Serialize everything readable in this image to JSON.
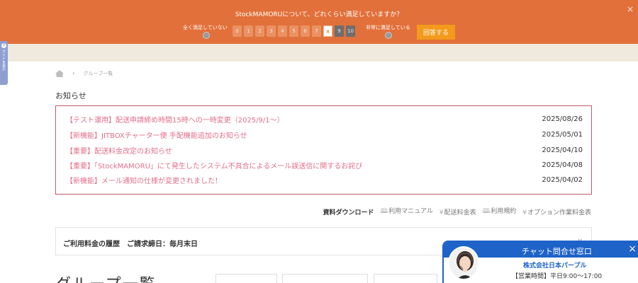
{
  "survey": {
    "question": "StockMAMORUについて、どれくらい満足していますか？",
    "low_label": "全く満足していない",
    "high_label": "非常に満足している",
    "scale": [
      "0",
      "1",
      "2",
      "3",
      "4",
      "5",
      "6",
      "7",
      "8",
      "9",
      "10"
    ],
    "selected": "8",
    "answer_label": "回答する",
    "close": "×"
  },
  "guide": {
    "icon": "?",
    "label": "ガイドを表示"
  },
  "breadcrumb": {
    "current": "グループ一覧",
    "separator": "›"
  },
  "news": {
    "title": "お知らせ",
    "items": [
      {
        "text": "【テスト運用】配送申請締め時間15時への一時変更（2025/9/1〜）",
        "date": "2025/08/26"
      },
      {
        "text": "【新機能】JITBOXチャーター便 手配機能追加のお知らせ",
        "date": "2025/05/01"
      },
      {
        "text": "【重要】配送料金改定のお知らせ",
        "date": "2025/04/10"
      },
      {
        "text": "【重要】「StockMAMORU」にて発生したシステム不具合によるメール誤送信に関するお詫び",
        "date": "2025/04/08"
      },
      {
        "text": "【新機能】メール通知の仕様が変更されました！",
        "date": "2025/04/02"
      }
    ]
  },
  "downloads": {
    "title": "資料ダウンロード",
    "items": [
      {
        "icon": "book-icon",
        "glyph": "🕮",
        "label": "利用マニュアル"
      },
      {
        "icon": "yen-icon",
        "glyph": "¥",
        "label": "配送料金表"
      },
      {
        "icon": "book-icon",
        "glyph": "🕮",
        "label": "利用規約"
      },
      {
        "icon": "yen-icon",
        "glyph": "¥",
        "label": "オプション作業料金表"
      }
    ]
  },
  "history": {
    "label": "ご利用料金の履歴　ご請求締日：毎月末日",
    "chevron": "∨"
  },
  "group_heading": "グループ一覧",
  "chat": {
    "title": "チャット問合せ窓口",
    "close": "×",
    "company": "株式会社日本パープル",
    "hours": "【営業時間】平日9:00〜17:00"
  },
  "colors": {
    "survey_bg": "#e2703a",
    "answer_btn": "#f39a1d",
    "news_border": "#c0586a",
    "news_link": "#e2708a",
    "chat_blue": "#1e63c8",
    "guide_tab": "#8d9ed1"
  }
}
